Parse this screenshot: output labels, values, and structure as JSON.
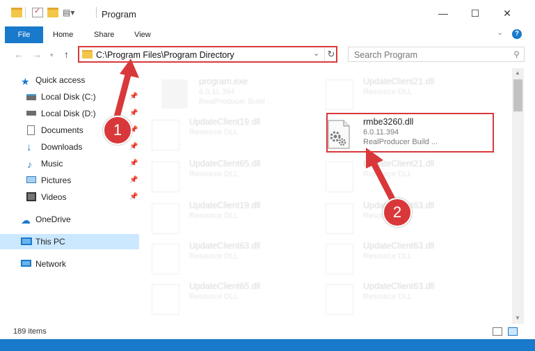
{
  "window": {
    "title": "Program",
    "minimize_icon": "minimize-icon",
    "maximize_icon": "maximize-icon",
    "close_icon": "close-icon"
  },
  "ribbon": {
    "tabs": [
      {
        "label": "File"
      },
      {
        "label": "Home"
      },
      {
        "label": "Share"
      },
      {
        "label": "View"
      }
    ],
    "help": "?"
  },
  "navigation": {
    "address": "C:\\Program Files\\Program Directory",
    "search_placeholder": "Search Program"
  },
  "sidebar": {
    "quick_access": "Quick access",
    "items": [
      {
        "label": "Local Disk (C:)",
        "icon": "drive-icon"
      },
      {
        "label": "Local Disk (D:)",
        "icon": "drive-icon"
      },
      {
        "label": "Documents",
        "icon": "documents-icon"
      },
      {
        "label": "Downloads",
        "icon": "downloads-icon"
      },
      {
        "label": "Music",
        "icon": "music-icon"
      },
      {
        "label": "Pictures",
        "icon": "pictures-icon"
      },
      {
        "label": "Videos",
        "icon": "videos-icon"
      }
    ],
    "onedrive": "OneDrive",
    "this_pc": "This PC",
    "network": "Network"
  },
  "files": {
    "col1": [
      {
        "name": "program.exe",
        "line2": "6.0.11.394",
        "line3": "RealProducer Build ..."
      },
      {
        "name": "UpdateClient19.dll",
        "line2": "Resource DLL"
      },
      {
        "name": "UpdateClient65.dll",
        "line2": "Resource DLL"
      },
      {
        "name": "UpdateClient19.dll",
        "line2": "Resource DLL"
      },
      {
        "name": "UpdateClient63.dll",
        "line2": "Resource DLL"
      },
      {
        "name": "UpdateClient65.dll",
        "line2": "Resource DLL"
      }
    ],
    "col2": [
      {
        "name": "UpdateClient21.dll",
        "line2": "Resource DLL"
      },
      {
        "name": "rmbe3260.dll",
        "line2": "6.0.11.394",
        "line3": "RealProducer Build ..."
      },
      {
        "name": "UpdateClient21.dll",
        "line2": "Resource DLL"
      },
      {
        "name": "UpdateClient63.dll",
        "line2": "Resource DLL"
      },
      {
        "name": "UpdateClient63.dll",
        "line2": "Resource DLL"
      },
      {
        "name": "UpdateClient63.dll",
        "line2": "Resource DLL"
      }
    ]
  },
  "status": {
    "item_count": "189 items"
  },
  "annotations": {
    "step1": "1",
    "step2": "2",
    "color": "#d9383a"
  }
}
